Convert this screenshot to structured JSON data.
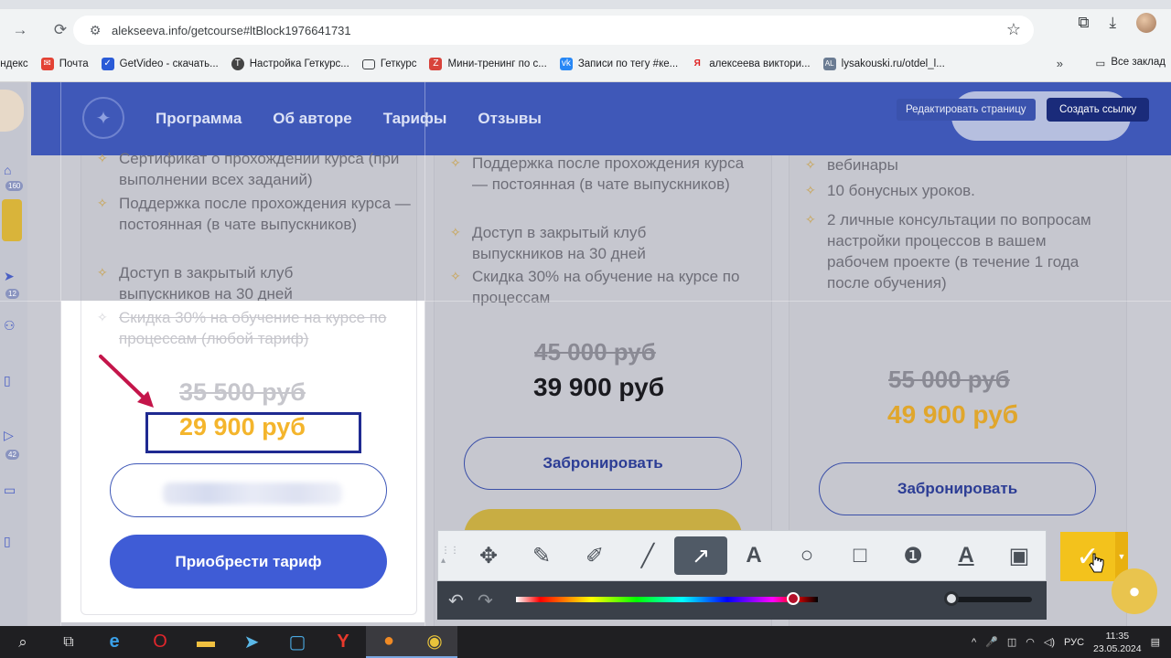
{
  "browser": {
    "url": "alekseeva.info/getcourse#ltBlock1976641731",
    "bookmarks": [
      {
        "label": "Яндекс",
        "icon": "yandex-icon"
      },
      {
        "label": "Почта",
        "icon": "mail-icon"
      },
      {
        "label": "GetVideo - скачать...",
        "icon": "getvideo-icon"
      },
      {
        "label": "Настройка Геткурс...",
        "icon": "getcourse-icon"
      },
      {
        "label": "Геткурс",
        "icon": "folder-icon"
      },
      {
        "label": "Мини-тренинг по с...",
        "icon": "zeta-icon"
      },
      {
        "label": "Записи по тегу #ке...",
        "icon": "vk-icon"
      },
      {
        "label": "алексеева виктори...",
        "icon": "yandex-icon"
      },
      {
        "label": "lysakouski.ru/otdel_l...",
        "icon": "al-icon"
      }
    ],
    "bookmarks_more": "»",
    "all_bookmarks": "Все заклад"
  },
  "site": {
    "nav": [
      "Программа",
      "Об авторе",
      "Тарифы",
      "Отзывы"
    ],
    "edit_page": "Редактировать страницу",
    "create_link": "Создать ссылку",
    "rail_badges": [
      "160",
      "12",
      "42"
    ]
  },
  "cards": [
    {
      "features": [
        "Сертификат о прохождении курса (при выполнении всех заданий)",
        "Поддержка после прохождения курса — постоянная (в чате выпускников)",
        "Доступ в закрытый клуб выпускников на 30 дней"
      ],
      "struck_feature": "Скидка 30% на обучение на курсе по процессам (любой тариф)",
      "old_price": "35 500 руб",
      "new_price": "29 900 руб",
      "book_button": "Забронировать",
      "buy_button": "Приобрести тариф",
      "new_price_color": "#f4b52c"
    },
    {
      "features": [
        "Поддержка после прохождения курса — постоянная (в чате выпускников)",
        "Доступ в закрытый клуб выпускников на 30 дней",
        "Скидка 30% на обучение на курсе по процессам"
      ],
      "old_price": "45 000 руб",
      "new_price": "39 900 руб",
      "book_button": "Забронировать",
      "new_price_color": "#1a1a1f"
    },
    {
      "features": [
        "вебинары",
        "10 бонусных уроков.",
        "2 личные консультации по вопросам настройки процессов в вашем рабочем проекте (в течение 1 года после обучения)"
      ],
      "old_price": "55 000 руб",
      "new_price": "49 900 руб",
      "book_button": "Забронировать",
      "new_price_color": "#e0a62c"
    }
  ],
  "screenshot_tool": {
    "tools": [
      "move-icon",
      "pencil-icon",
      "marker-icon",
      "line-icon",
      "arrow-icon",
      "text-icon",
      "ellipse-icon",
      "rectangle-icon",
      "counter-icon",
      "outlined-text-icon",
      "blur-icon"
    ],
    "active_tool": "arrow-icon",
    "accent": "#f3c21c",
    "selected_color": "#b3102a"
  },
  "taskbar": {
    "apps": [
      "search-icon",
      "task-view-icon",
      "edge-icon",
      "opera-icon",
      "explorer-icon",
      "telegram-icon",
      "snipping-icon",
      "yandex-browser-icon",
      "firefox-icon",
      "chrome-icon"
    ],
    "language": "РУС",
    "time": "11:35",
    "date": "23.05.2024"
  }
}
